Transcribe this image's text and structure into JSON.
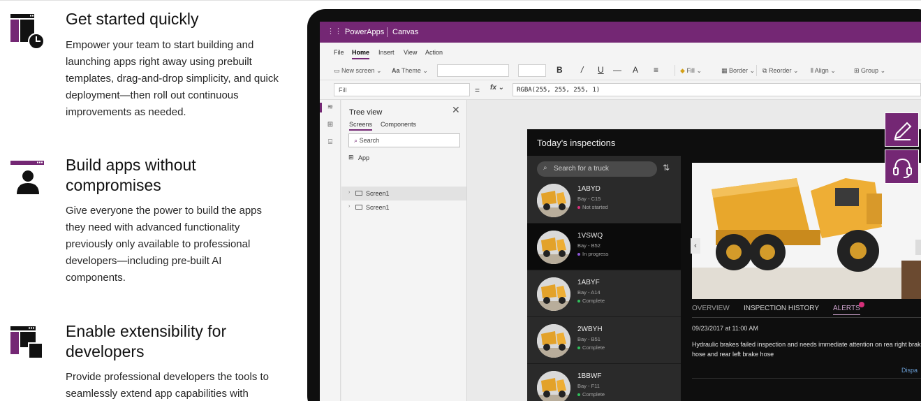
{
  "features": [
    {
      "title": "Get started quickly",
      "body": "Empower your team to start building and launching apps right away using prebuilt templates, drag-and-drop simplicity, and quick deployment—then roll out continuous improvements as needed.",
      "icon": "app-clock-icon"
    },
    {
      "title": "Build apps without compromises",
      "body": "Give everyone the power to build the apps they need with advanced functionality previously only available to professional developers—including pre-built AI components.",
      "icon": "app-user-icon"
    },
    {
      "title": "Enable extensibility for developers",
      "body": "Provide professional developers the tools to seamlessly extend app capabilities with",
      "icon": "app-extend-icon"
    }
  ],
  "studio": {
    "brand": "PowerApps",
    "mode": "Canvas",
    "menu": [
      "File",
      "Home",
      "Insert",
      "View",
      "Action"
    ],
    "active_menu": "Home",
    "ribbon": {
      "new_screen": "New screen",
      "theme": "Theme",
      "bold": "B",
      "italic": "/",
      "underline": "U",
      "strike": "—",
      "font_size": "A",
      "align_text": "≡",
      "fill": "Fill",
      "border": "Border",
      "reorder": "Reorder",
      "align": "Align",
      "group": "Group"
    },
    "formula": {
      "property": "Fill",
      "equals": "=",
      "fx": "fx",
      "value": "RGBA(255, 255, 255, 1)"
    },
    "tree": {
      "title": "Tree view",
      "tabs": [
        "Screens",
        "Components"
      ],
      "search_placeholder": "Search",
      "app_label": "App",
      "screens": [
        "Screen1",
        "Screen1"
      ]
    }
  },
  "inspection_app": {
    "title": "Today's inspections",
    "search_placeholder": "Search for a truck",
    "trucks": [
      {
        "id": "1ABYD",
        "bay": "Bay - C15",
        "status": "Not started",
        "status_color": "#d6307a"
      },
      {
        "id": "1VSWQ",
        "bay": "Bay - B52",
        "status": "In progress",
        "status_color": "#8a56d6"
      },
      {
        "id": "1ABYF",
        "bay": "Bay - A14",
        "status": "Complete",
        "status_color": "#2fbf5b"
      },
      {
        "id": "2WBYH",
        "bay": "Bay - B51",
        "status": "Complete",
        "status_color": "#2fbf5b"
      },
      {
        "id": "1BBWF",
        "bay": "Bay - F11",
        "status": "Complete",
        "status_color": "#2fbf5b"
      }
    ],
    "selected_index": 1,
    "detail_tabs": [
      "OVERVIEW",
      "INSPECTION HISTORY",
      "ALERTS"
    ],
    "active_detail_tab": "ALERTS",
    "alert_date": "09/23/2017 at 11:00 AM",
    "alert_text": "Hydraulic brakes failed inspection and needs immediate attention on rea right brake hose and rear left brake hose",
    "link_text": "Dispa"
  },
  "fabs": [
    "edit-icon",
    "headset-icon"
  ],
  "colors": {
    "accent": "#742774",
    "app_bg": "#0e0e0e",
    "list_bg": "#2a2a2a",
    "link": "#6b9fd6"
  }
}
